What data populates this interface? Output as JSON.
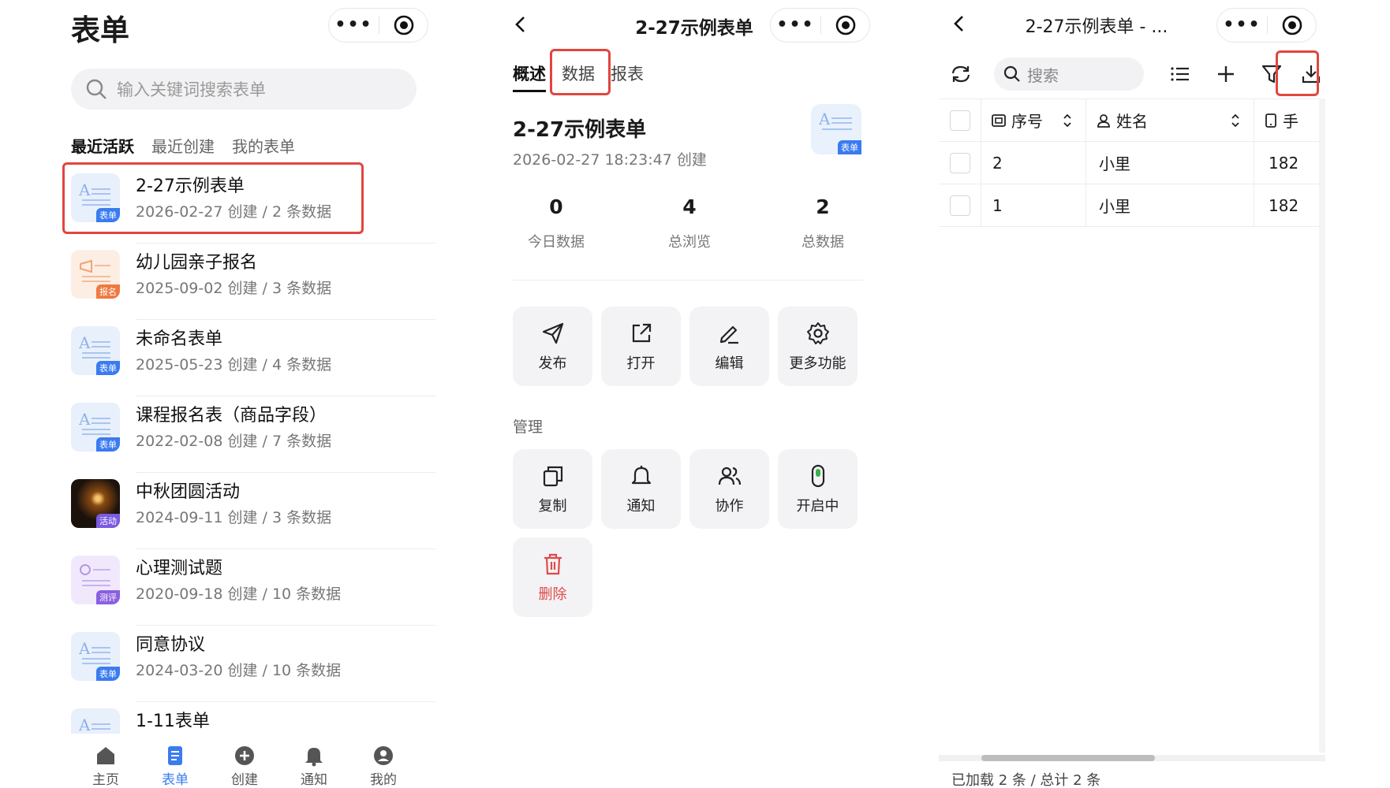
{
  "panel1": {
    "title": "表单",
    "search_placeholder": "输入关键词搜索表单",
    "tabs": [
      "最近活跃",
      "最近创建",
      "我的表单"
    ],
    "forms": [
      {
        "name": "2-27示例表单",
        "meta": "2026-02-27 创建 / 2 条数据",
        "badge": "表单",
        "kind": "form"
      },
      {
        "name": "幼儿园亲子报名",
        "meta": "2025-09-02 创建 / 3 条数据",
        "badge": "报名",
        "kind": "signup"
      },
      {
        "name": "未命名表单",
        "meta": "2025-05-23 创建 / 4 条数据",
        "badge": "表单",
        "kind": "form"
      },
      {
        "name": "课程报名表（商品字段）",
        "meta": "2022-02-08 创建 / 7 条数据",
        "badge": "表单",
        "kind": "form"
      },
      {
        "name": "中秋团圆活动",
        "meta": "2024-09-11 创建 / 3 条数据",
        "badge": "活动",
        "kind": "activity"
      },
      {
        "name": "心理测试题",
        "meta": "2020-09-18 创建 / 10 条数据",
        "badge": "测评",
        "kind": "quiz"
      },
      {
        "name": "同意协议",
        "meta": "2024-03-20 创建 / 10 条数据",
        "badge": "表单",
        "kind": "form"
      },
      {
        "name": "1-11表单",
        "meta": "",
        "badge": "",
        "kind": "form"
      }
    ],
    "nav": [
      "主页",
      "表单",
      "创建",
      "通知",
      "我的"
    ],
    "nav_active": "表单"
  },
  "panel2": {
    "title": "2-27示例表单",
    "tabs": [
      "概述",
      "数据",
      "报表"
    ],
    "form_title": "2-27示例表单",
    "created": "2026-02-27 18:23:47 创建",
    "icon_badge": "表单",
    "stats": [
      {
        "value": "0",
        "label": "今日数据"
      },
      {
        "value": "4",
        "label": "总浏览"
      },
      {
        "value": "2",
        "label": "总数据"
      }
    ],
    "actions": [
      "发布",
      "打开",
      "编辑",
      "更多功能"
    ],
    "manage_label": "管理",
    "manage": [
      "复制",
      "通知",
      "协作",
      "开启中"
    ],
    "delete_label": "删除"
  },
  "panel3": {
    "title": "2-27示例表单 - ...",
    "search_placeholder": "搜索",
    "columns": [
      "序号",
      "姓名",
      "手"
    ],
    "rows": [
      {
        "seq": "2",
        "name": "小里",
        "phone": "182"
      },
      {
        "seq": "1",
        "name": "小里",
        "phone": "182"
      }
    ],
    "footer": "已加载 2 条 / 总计 2 条"
  },
  "colors": {
    "accent": "#3a7bf0",
    "highlight": "#e0463f",
    "danger": "#e04a4a"
  }
}
